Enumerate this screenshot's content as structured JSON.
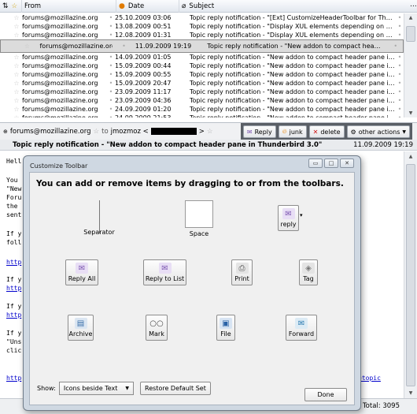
{
  "columns": {
    "from": "From",
    "date": "Date",
    "subject": "Subject"
  },
  "messages": [
    {
      "from": "forums@mozillazine.org",
      "date": "25.10.2009 03:06",
      "subject": "Topic reply notification - \"[Ext] CustomizeHeaderToolbar for Thund...",
      "selected": false
    },
    {
      "from": "forums@mozillazine.org",
      "date": "13.08.2009 00:51",
      "subject": "Topic reply notification - \"Display XUL elements depending on prefe...",
      "selected": false
    },
    {
      "from": "forums@mozillazine.org",
      "date": "12.08.2009 01:31",
      "subject": "Topic reply notification - \"Display XUL elements depending on prefe...",
      "selected": false
    },
    {
      "from": "forums@mozillazine.org",
      "date": "11.09.2009 19:19",
      "subject": "Topic reply notification - \"New addon to compact header pane in T...",
      "selected": true
    },
    {
      "from": "forums@mozillazine.org",
      "date": "14.09.2009 01:05",
      "subject": "Topic reply notification - \"New addon to compact header pane in T...",
      "selected": false
    },
    {
      "from": "forums@mozillazine.org",
      "date": "15.09.2009 00:44",
      "subject": "Topic reply notification - \"New addon to compact header pane in T...",
      "selected": false
    },
    {
      "from": "forums@mozillazine.org",
      "date": "15.09.2009 00:55",
      "subject": "Topic reply notification - \"New addon to compact header pane in T...",
      "selected": false
    },
    {
      "from": "forums@mozillazine.org",
      "date": "15.09.2009 20:47",
      "subject": "Topic reply notification - \"New addon to compact header pane in T...",
      "selected": false
    },
    {
      "from": "forums@mozillazine.org",
      "date": "23.09.2009 11:17",
      "subject": "Topic reply notification - \"New addon to compact header pane in T...",
      "selected": false
    },
    {
      "from": "forums@mozillazine.org",
      "date": "23.09.2009 04:36",
      "subject": "Topic reply notification - \"New addon to compact header pane in T...",
      "selected": false
    },
    {
      "from": "forums@mozillazine.org",
      "date": "24.09.2009 01:20",
      "subject": "Topic reply notification - \"New addon to compact header pane in T...",
      "selected": false
    },
    {
      "from": "forums@mozillazine.org",
      "date": "24.09.2009 21:53",
      "subject": "Topic reply notification - \"New addon to compact header pane in T...",
      "selected": false
    }
  ],
  "header": {
    "from": "forums@mozillazine.org",
    "to_label": "to",
    "to": "jmozmoz <",
    "to_end": ">",
    "buttons": {
      "reply": "Reply",
      "junk": "junk",
      "delete": "delete",
      "other": "other actions"
    },
    "subject": "Topic reply notification - \"New addon to compact header pane in Thunderbird 3.0\"",
    "date": "11.09.2009 19:19"
  },
  "body": {
    "lines": [
      "Hell",
      "You ",
      "\"New",
      "Foru",
      "the ",
      "sent",
      "If y",
      "foll",
      "http",
      "If y",
      "http",
      "If y",
      "http",
      "If y",
      "\"Uns",
      "clic",
      "http"
    ],
    "right_fragments": [
      "s",
      "etopic"
    ]
  },
  "status": {
    "total": "Total: 3095"
  },
  "dialog": {
    "title": "Customize Toolbar",
    "heading": "You can add or remove items by dragging to or from the toolbars.",
    "items": {
      "separator": "Separator",
      "space": "Space",
      "reply": "reply",
      "reply_all": "Reply All",
      "reply_to_list": "Reply to List",
      "print": "Print",
      "tag": "Tag",
      "archive": "Archive",
      "mark": "Mark",
      "file": "File",
      "forward": "Forward"
    },
    "show_label": "Show:",
    "show_value": "Icons beside Text",
    "restore_label": "Restore Default Set",
    "done_label": "Done"
  }
}
